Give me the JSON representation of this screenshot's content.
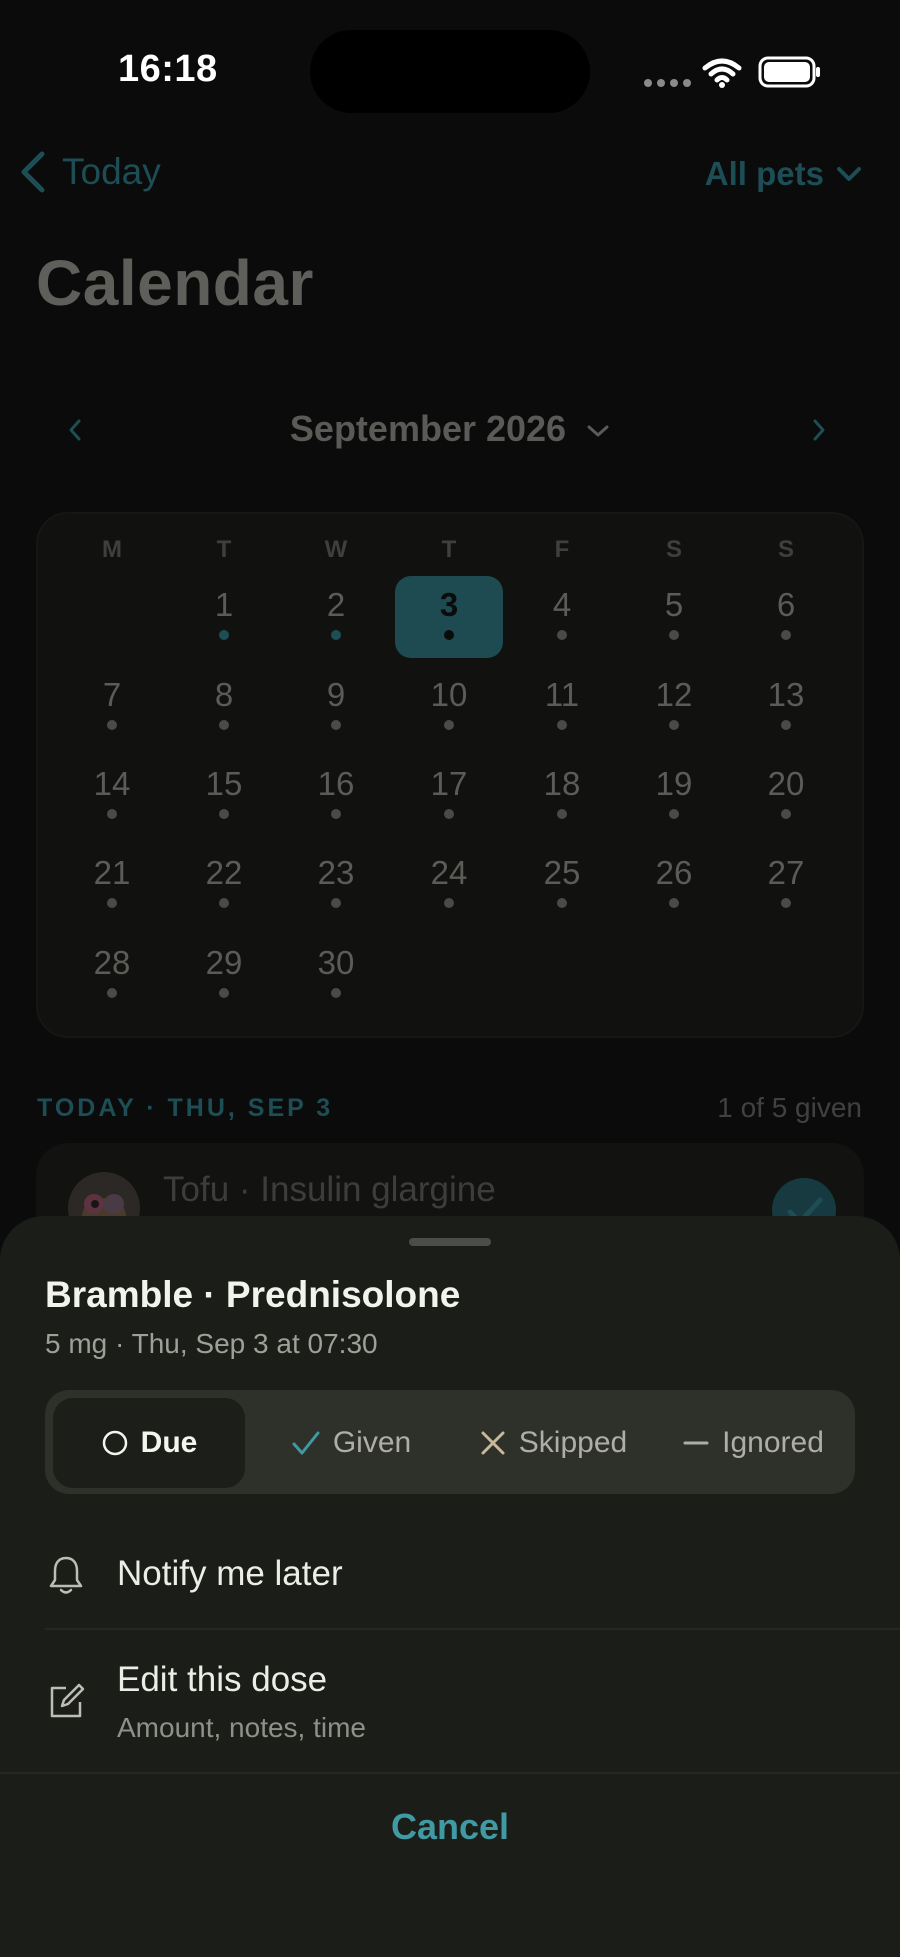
{
  "status_bar": {
    "time": "16:18"
  },
  "nav": {
    "back_label": "Today",
    "pets_filter": "All pets"
  },
  "page": {
    "title": "Calendar"
  },
  "calendar": {
    "month_label": "September 2026",
    "weekdays": [
      "M",
      "T",
      "W",
      "T",
      "F",
      "S",
      "S"
    ],
    "days": [
      "1",
      "2",
      "3",
      "4",
      "5",
      "6",
      "7",
      "8",
      "9",
      "10",
      "11",
      "12",
      "13",
      "14",
      "15",
      "16",
      "17",
      "18",
      "19",
      "20",
      "21",
      "22",
      "23",
      "24",
      "25",
      "26",
      "27",
      "28",
      "29",
      "30"
    ],
    "selected_day": "3"
  },
  "today": {
    "section_title": "TODAY · THU, SEP 3",
    "count": "1 of 5 given",
    "dose_label": "Tofu · Insulin glargine"
  },
  "sheet": {
    "title": "Bramble · Prednisolone",
    "subtitle": "5 mg · Thu, Sep 3 at 07:30",
    "segments": [
      {
        "label": "Due",
        "icon": "circle-icon"
      },
      {
        "label": "Given",
        "icon": "checkmark-icon"
      },
      {
        "label": "Skipped",
        "icon": "x-icon"
      },
      {
        "label": "Ignored",
        "icon": "dash-icon"
      }
    ],
    "active_segment": "Due",
    "notify_label": "Notify me later",
    "edit_label": "Edit this dose",
    "edit_sublabel": "Amount, notes, time",
    "cancel_label": "Cancel"
  },
  "colors": {
    "accent": "#3f9aa4",
    "sheet_background": "#1b1d19",
    "dimmed_accent": "#1d4d55"
  }
}
